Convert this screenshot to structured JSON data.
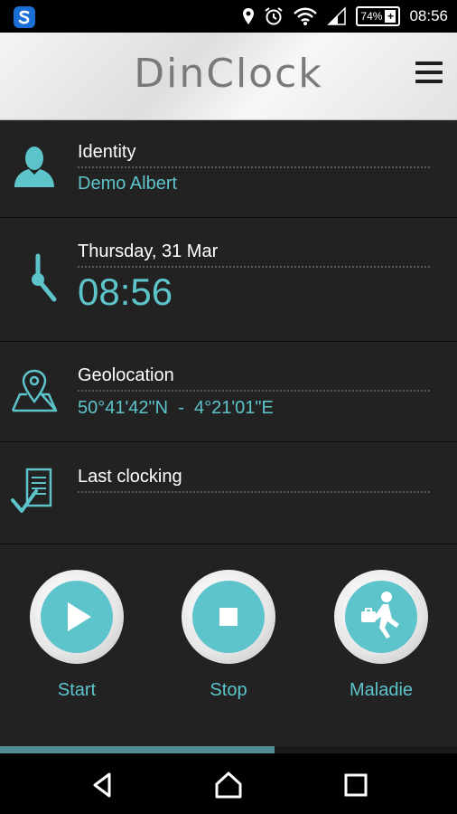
{
  "status_bar": {
    "battery": "74%",
    "time": "08:56",
    "left_icon": "s-logo-icon"
  },
  "header": {
    "title": "DinClock",
    "menu_icon": "hamburger-menu-icon"
  },
  "sections": {
    "identity": {
      "label": "Identity",
      "value": "Demo Albert"
    },
    "datetime": {
      "label": "Thursday, 31 Mar",
      "value": "08:56"
    },
    "geolocation": {
      "label": "Geolocation",
      "value": "50°41'42\"N  -  4°21'01\"E"
    },
    "last_clocking": {
      "label": "Last clocking",
      "value": ""
    }
  },
  "actions": [
    {
      "label": "Start",
      "icon": "play-icon"
    },
    {
      "label": "Stop",
      "icon": "stop-icon"
    },
    {
      "label": "Maladie",
      "icon": "running-man-icon"
    }
  ],
  "progress": {
    "fraction": 0.6
  },
  "colors": {
    "accent": "#5ec4cc",
    "background": "#222222",
    "progress": "#4f8d93"
  },
  "nav": {
    "back": "back-icon",
    "home": "home-icon",
    "recent": "recent-apps-icon"
  }
}
